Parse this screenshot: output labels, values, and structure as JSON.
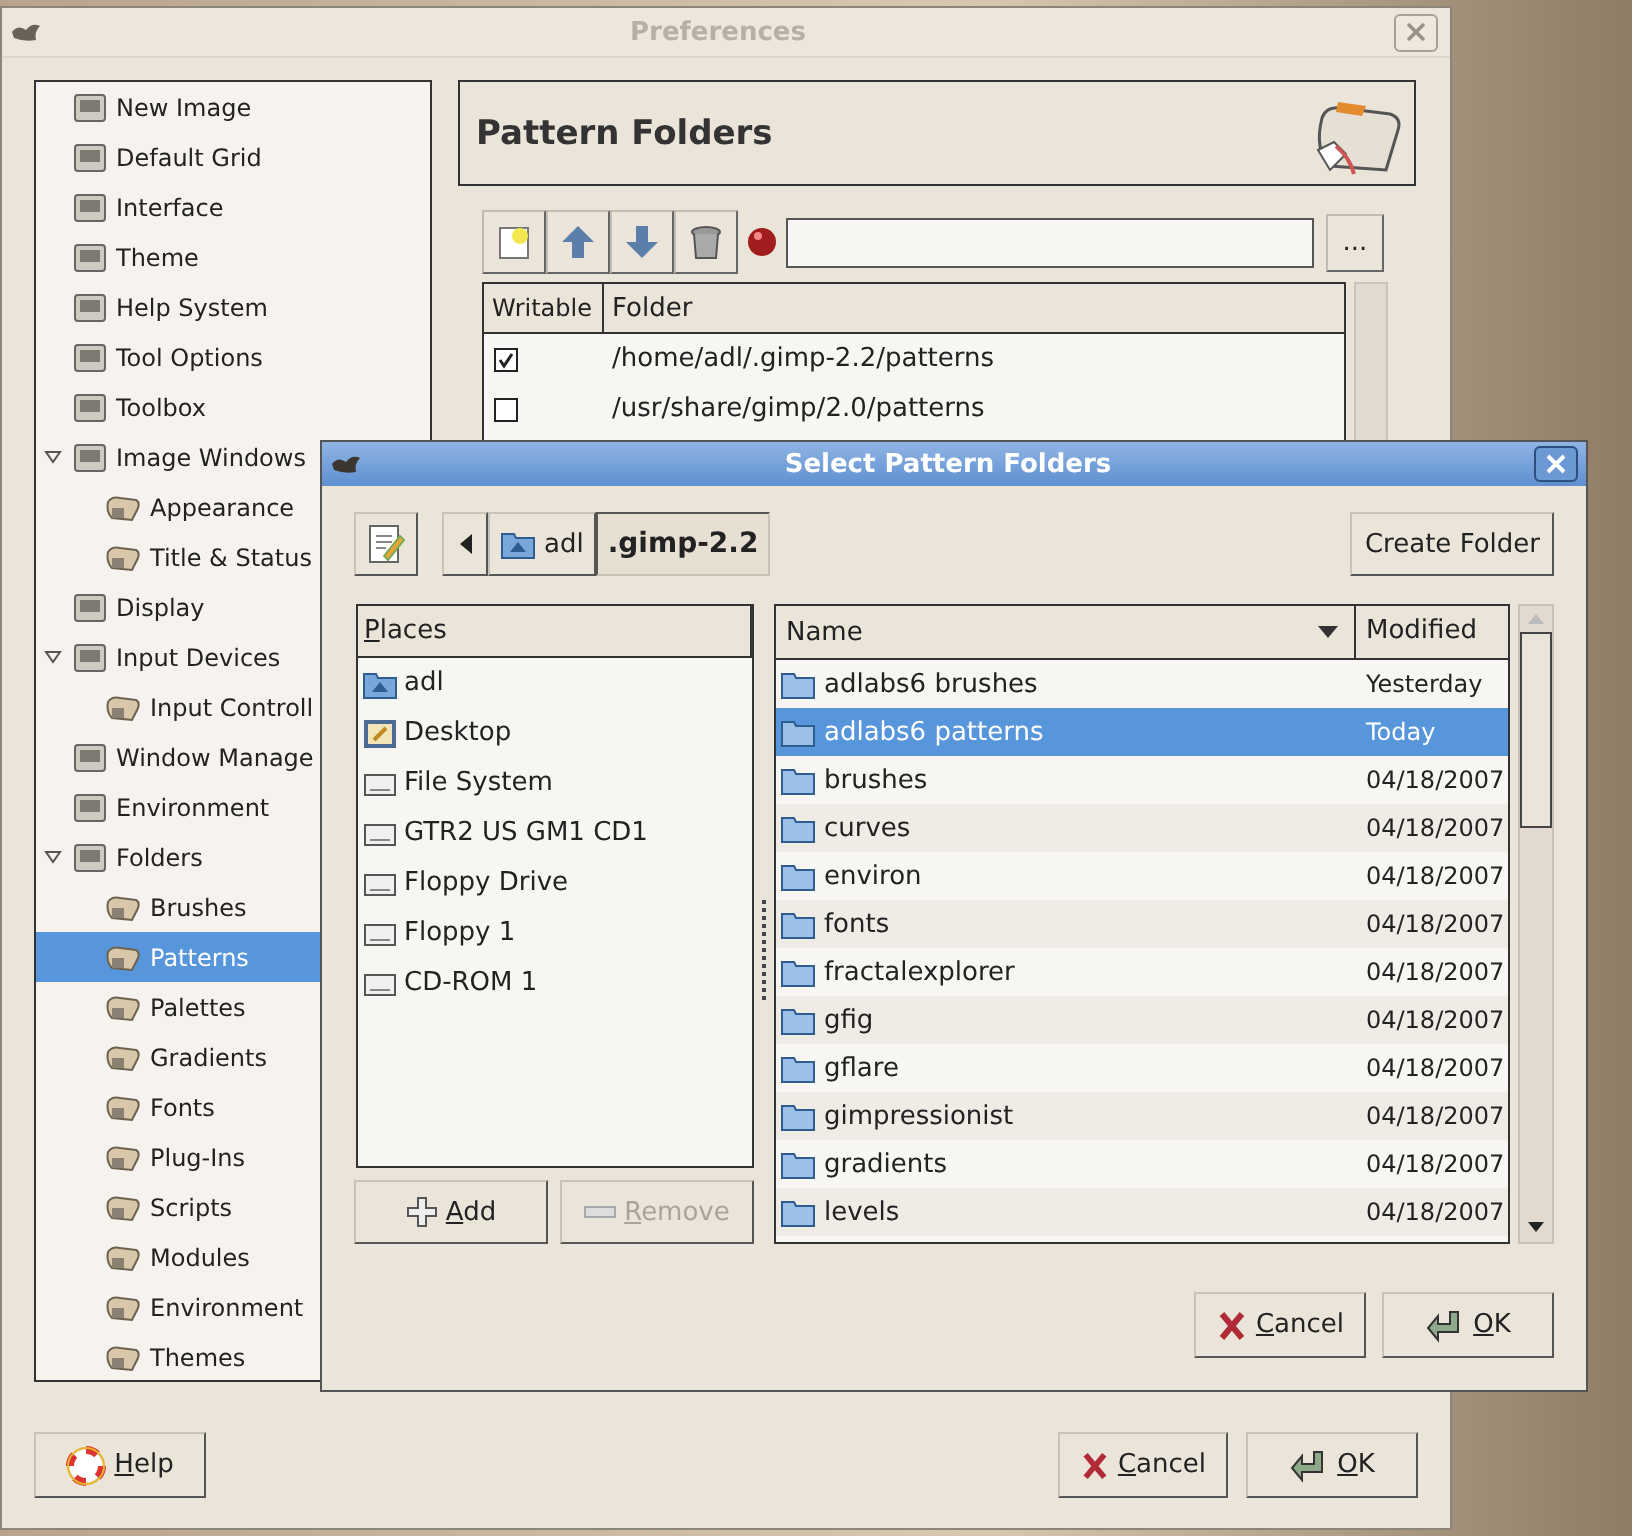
{
  "preferences": {
    "title": "Preferences",
    "active": false,
    "sidebar": {
      "items": [
        {
          "label": "New Image",
          "selected": false
        },
        {
          "label": "Default Grid",
          "selected": false
        },
        {
          "label": "Interface",
          "selected": false
        },
        {
          "label": "Theme",
          "selected": false
        },
        {
          "label": "Help System",
          "selected": false
        },
        {
          "label": "Tool Options",
          "selected": false
        },
        {
          "label": "Toolbox",
          "selected": false
        },
        {
          "label": "Image Windows",
          "selected": false,
          "expanded": true,
          "children": [
            {
              "label": "Appearance",
              "selected": false
            },
            {
              "label": "Title & Status",
              "selected": false
            }
          ]
        },
        {
          "label": "Display",
          "selected": false
        },
        {
          "label": "Input Devices",
          "selected": false,
          "expanded": true,
          "children": [
            {
              "label": "Input Controll",
              "selected": false
            }
          ]
        },
        {
          "label": "Window Manage",
          "selected": false
        },
        {
          "label": "Environment",
          "selected": false
        },
        {
          "label": "Folders",
          "selected": false,
          "expanded": true,
          "children": [
            {
              "label": "Brushes",
              "selected": false
            },
            {
              "label": "Patterns",
              "selected": true
            },
            {
              "label": "Palettes",
              "selected": false
            },
            {
              "label": "Gradients",
              "selected": false
            },
            {
              "label": "Fonts",
              "selected": false
            },
            {
              "label": "Plug-Ins",
              "selected": false
            },
            {
              "label": "Scripts",
              "selected": false
            },
            {
              "label": "Modules",
              "selected": false
            },
            {
              "label": "Environment",
              "selected": false
            },
            {
              "label": "Themes",
              "selected": false
            }
          ]
        }
      ]
    },
    "page": {
      "title": "Pattern Folders",
      "browse_button": "...",
      "columns": [
        "Writable",
        "Folder"
      ],
      "rows": [
        {
          "writable": true,
          "folder": "/home/adl/.gimp-2.2/patterns"
        },
        {
          "writable": false,
          "folder": "/usr/share/gimp/2.0/patterns"
        }
      ]
    },
    "buttons": [
      {
        "label": "Help",
        "kind": "help"
      },
      {
        "label": "Cancel",
        "kind": "cancel"
      },
      {
        "label": "OK",
        "kind": "ok"
      }
    ]
  },
  "dialog": {
    "title": "Select Pattern Folders",
    "active": true,
    "path": [
      {
        "label": "adl",
        "kind": "home",
        "selected": false
      },
      {
        "label": ".gimp-2.2",
        "kind": "plain",
        "selected": true
      }
    ],
    "create_folder": "Create Folder",
    "places": {
      "header": "Places",
      "items": [
        {
          "label": "adl",
          "kind": "home"
        },
        {
          "label": "Desktop",
          "kind": "desktop"
        },
        {
          "label": "File System",
          "kind": "drive"
        },
        {
          "label": "GTR2 US GM1 CD1",
          "kind": "drive"
        },
        {
          "label": "Floppy Drive",
          "kind": "drive"
        },
        {
          "label": "Floppy 1",
          "kind": "drive"
        },
        {
          "label": "CD-ROM 1",
          "kind": "drive"
        }
      ]
    },
    "place_buttons": [
      {
        "label": "Add",
        "kind": "add",
        "disabled": false
      },
      {
        "label": "Remove",
        "kind": "remove",
        "disabled": true
      }
    ],
    "files": {
      "columns": [
        "Name",
        "Modified"
      ],
      "rows": [
        {
          "name": "adlabs6 brushes",
          "modified": "Yesterday",
          "selected": false
        },
        {
          "name": "adlabs6 patterns",
          "modified": "Today",
          "selected": true
        },
        {
          "name": "brushes",
          "modified": "04/18/2007",
          "selected": false
        },
        {
          "name": "curves",
          "modified": "04/18/2007",
          "selected": false
        },
        {
          "name": "environ",
          "modified": "04/18/2007",
          "selected": false
        },
        {
          "name": "fonts",
          "modified": "04/18/2007",
          "selected": false
        },
        {
          "name": "fractalexplorer",
          "modified": "04/18/2007",
          "selected": false
        },
        {
          "name": "gfig",
          "modified": "04/18/2007",
          "selected": false
        },
        {
          "name": "gflare",
          "modified": "04/18/2007",
          "selected": false
        },
        {
          "name": "gimpressionist",
          "modified": "04/18/2007",
          "selected": false
        },
        {
          "name": "gradients",
          "modified": "04/18/2007",
          "selected": false
        },
        {
          "name": "levels",
          "modified": "04/18/2007",
          "selected": false
        }
      ]
    },
    "buttons": [
      {
        "label": "Cancel",
        "kind": "cancel"
      },
      {
        "label": "OK",
        "kind": "ok"
      }
    ]
  }
}
